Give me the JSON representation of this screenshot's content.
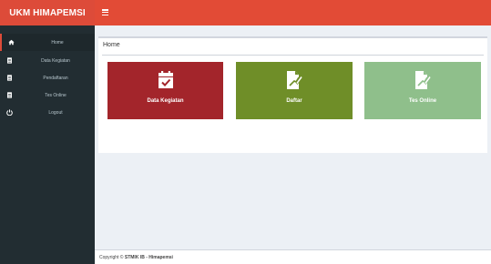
{
  "app": {
    "brand": "UKM HIMAPEMSI"
  },
  "sidebar": {
    "items": [
      {
        "label": "Home",
        "icon": "home-icon",
        "active": true
      },
      {
        "label": "Data Kegiatan",
        "icon": "document-icon"
      },
      {
        "label": "Pendaftaran",
        "icon": "document-icon"
      },
      {
        "label": "Tes Online",
        "icon": "document-icon"
      },
      {
        "label": "Logout",
        "icon": "power-icon"
      }
    ]
  },
  "main": {
    "box_title": "Home",
    "tiles": [
      {
        "label": "Data Kegiatan",
        "icon": "calendar-check-icon",
        "color": "#a3252b"
      },
      {
        "label": "Daftar",
        "icon": "edit-document-icon",
        "color": "#6f8e28"
      },
      {
        "label": "Tes Online",
        "icon": "edit-document-icon",
        "color": "#8fbf8b"
      }
    ]
  },
  "footer": {
    "prefix": "Copyright © ",
    "org": "STMIK IB - Himapemsi"
  },
  "colors": {
    "header": "#e24b36",
    "brand_bg": "#dd4b39",
    "sidebar_bg": "#222d32",
    "content_bg": "#ecf0f5"
  }
}
